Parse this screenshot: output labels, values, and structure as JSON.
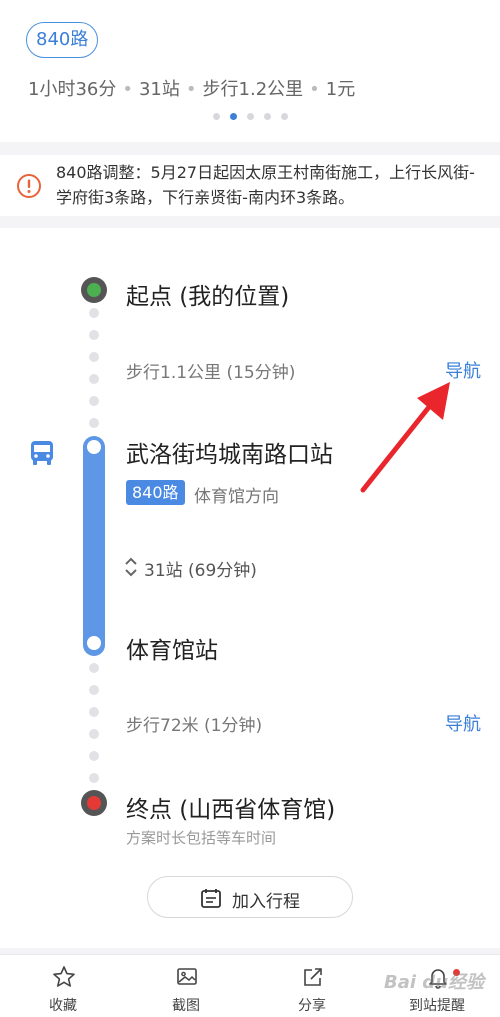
{
  "header": {
    "route_chip": "840路",
    "summary": {
      "duration": "1小时36分",
      "stops": "31站",
      "walk": "步行1.2公里",
      "fare": "1元"
    },
    "pager": {
      "total": 5,
      "active": 2
    }
  },
  "notice": {
    "icon": "info-icon",
    "text": "840路调整：5月27日起因太原王村南街施工，上行长风街-学府街3条路，下行亲贤街-南内环3条路。"
  },
  "timeline": {
    "start": {
      "title": "起点 (我的位置)",
      "color": "#4caf50"
    },
    "walk1": {
      "text": "步行1.1公里 (15分钟)",
      "nav": "导航"
    },
    "board": {
      "title": "武洛街坞城南路口站",
      "route_tag": "840路",
      "direction": "体育馆方向",
      "ride": "31站 (69分钟)"
    },
    "alight": {
      "title": "体育馆站"
    },
    "walk2": {
      "text": "步行72米 (1分钟)",
      "nav": "导航"
    },
    "end": {
      "title": "终点 (山西省体育馆)",
      "note": "方案时长包括等车时间",
      "color": "#e53935"
    }
  },
  "actions": {
    "add_trip": "加入行程"
  },
  "bottom_tabs": [
    {
      "label": "收藏",
      "icon": "star-icon"
    },
    {
      "label": "截图",
      "icon": "image-icon"
    },
    {
      "label": "分享",
      "icon": "share-icon"
    },
    {
      "label": "到站提醒",
      "icon": "bell-icon"
    }
  ],
  "watermark": "Bai du经验",
  "colors": {
    "accent": "#3b7fd8",
    "route_bar": "#5d97e6",
    "annotation_arrow": "#e8262c"
  }
}
